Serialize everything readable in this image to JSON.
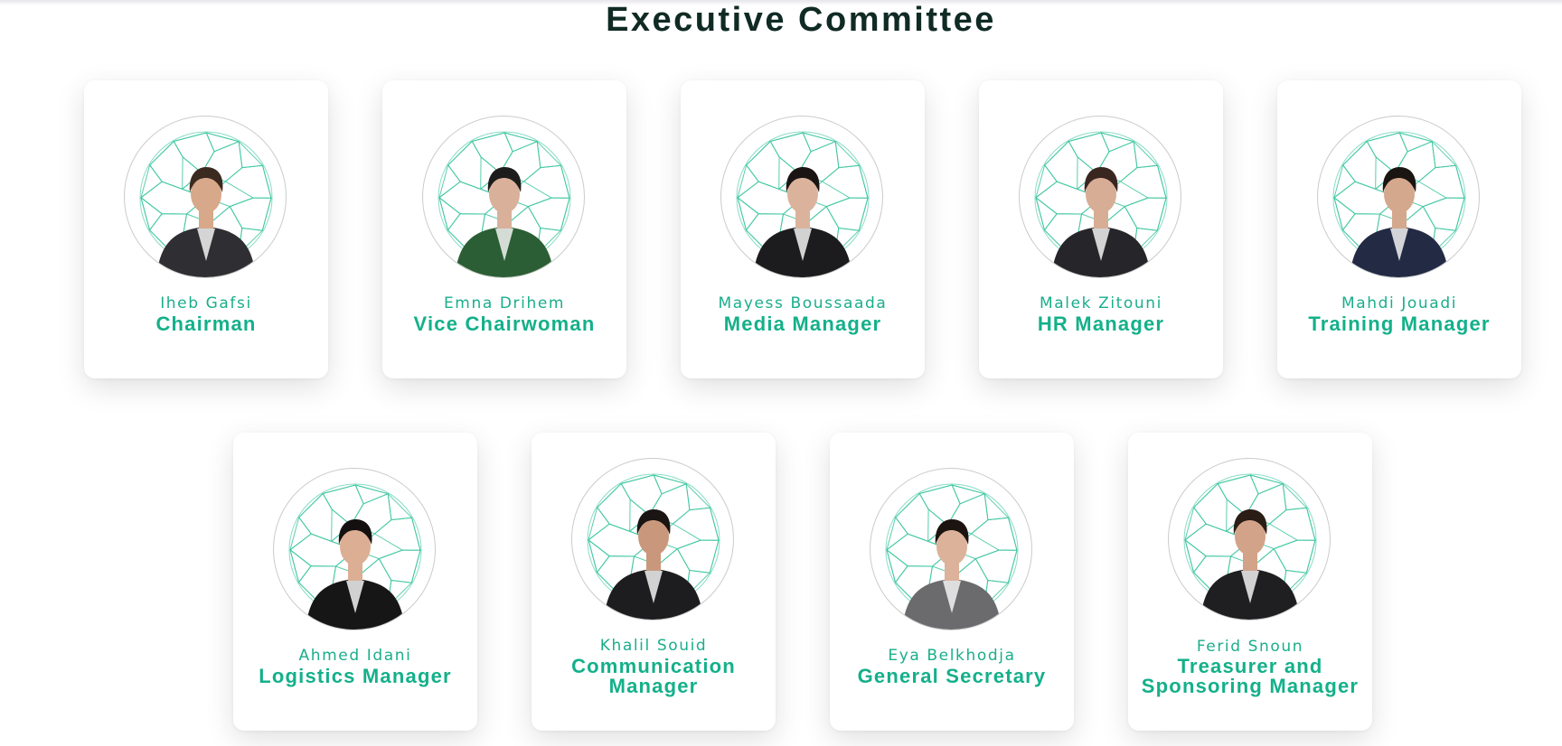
{
  "page": {
    "title": "Executive Committee"
  },
  "accent": "#14b08a",
  "members": [
    {
      "name": "Iheb Gafsi",
      "role": "Chairman",
      "outfit": "#2f2f33",
      "hair": "#3a2a20",
      "skin": "#d8a88a"
    },
    {
      "name": "Emna Drihem",
      "role": "Vice Chairwoman",
      "outfit": "#2b5e34",
      "hair": "#1c1c1c",
      "skin": "#d9b09a"
    },
    {
      "name": "Mayess Boussaada",
      "role": "Media Manager",
      "outfit": "#1c1c1e",
      "hair": "#1a1514",
      "skin": "#dbb39c"
    },
    {
      "name": "Malek Zitouni",
      "role": "HR Manager",
      "outfit": "#26262a",
      "hair": "#3a2620",
      "skin": "#d8ad95"
    },
    {
      "name": "Mahdi Jouadi",
      "role": "Training Manager",
      "outfit": "#222a44",
      "hair": "#1a1412",
      "skin": "#d4a88d"
    },
    {
      "name": "Ahmed Idani",
      "role": "Logistics Manager",
      "outfit": "#161616",
      "hair": "#141010",
      "skin": "#dcae94"
    },
    {
      "name": "Khalil Souid",
      "role": "Communication Manager",
      "outfit": "#1d1d1f",
      "hair": "#1a1412",
      "skin": "#c9987c"
    },
    {
      "name": "Eya Belkhodja",
      "role": "General Secretary",
      "outfit": "#6b6b6e",
      "hair": "#1b1410",
      "skin": "#dcb29a"
    },
    {
      "name": "Ferid Snoun",
      "role": "Treasurer and Sponsoring Manager",
      "outfit": "#1f1f21",
      "hair": "#2a1d16",
      "skin": "#d2a388"
    }
  ]
}
